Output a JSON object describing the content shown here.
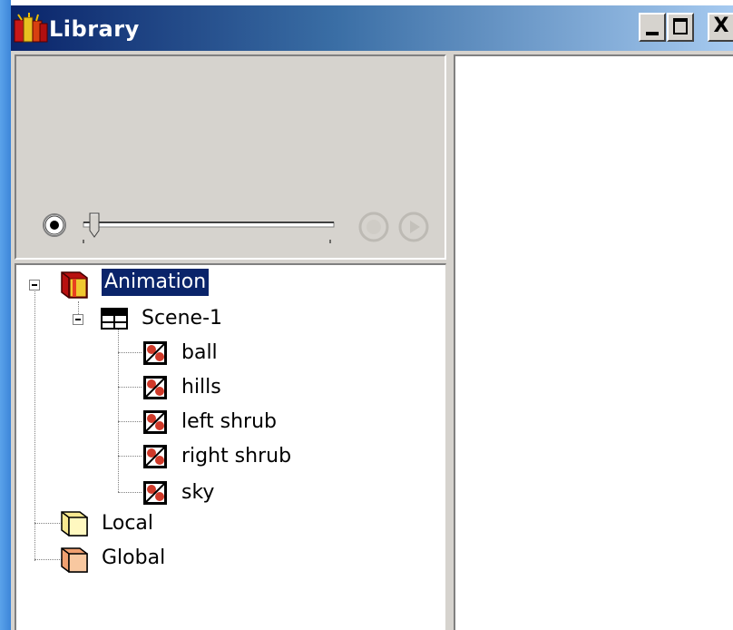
{
  "window": {
    "title": "Library",
    "caption_buttons": {
      "minimize": "minimize",
      "maximize": "maximize",
      "close": "X"
    }
  },
  "player": {
    "scrubber_position": 0.0
  },
  "tree": {
    "root": {
      "label": "Animation",
      "icon": "folder-red-icon",
      "expanded": true,
      "selected": true
    },
    "scene": {
      "label": "Scene-1",
      "icon": "scene-icon",
      "expanded": true
    },
    "symbols": [
      {
        "label": "ball",
        "icon": "symbol-icon"
      },
      {
        "label": "hills",
        "icon": "symbol-icon"
      },
      {
        "label": "left shrub",
        "icon": "symbol-icon"
      },
      {
        "label": "right shrub",
        "icon": "symbol-icon"
      },
      {
        "label": "sky",
        "icon": "symbol-icon"
      }
    ],
    "folders": [
      {
        "label": "Local",
        "icon": "folder-yellow-icon"
      },
      {
        "label": "Global",
        "icon": "folder-orange-icon"
      }
    ]
  },
  "colors": {
    "title_gradient_start": "#0a246a",
    "title_gradient_end": "#a6caf0",
    "selection": "#0a246a",
    "panel_bg": "#d6d3ce"
  }
}
